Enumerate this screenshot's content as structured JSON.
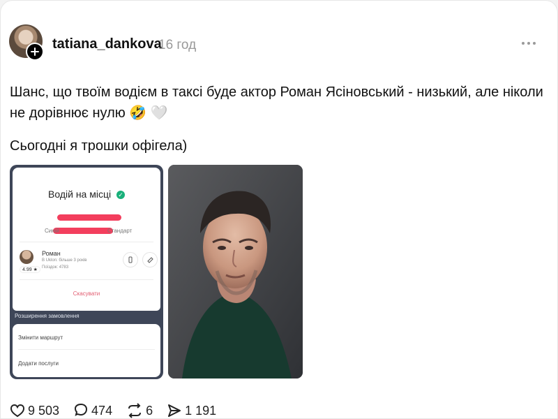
{
  "post": {
    "username": "tatiana_dankova",
    "time": "16 год",
    "text_line1": "Шанс, що твоїм водієм в таксі буде актор Роман Ясіновський - низький, але ніколи",
    "text_line2_prefix": "не дорівнює нулю",
    "emoji": [
      "🤣",
      "🤍"
    ],
    "text2": "Сьогодні я трошки офігела)"
  },
  "taxi_screenshot": {
    "title": "Водій на місці",
    "car_color": "Синій",
    "tariff": "Стандарт",
    "driver_name": "Роман",
    "rating": "4.99 ★",
    "line1": "В Uklon: більше 3 років",
    "line2": "Поїздок: 4783",
    "cancel": "Скасувати",
    "section": "Розширення замовлення",
    "option1": "Змінити маршрут",
    "option2": "Додати послуги"
  },
  "stats": {
    "likes": "9 503",
    "comments": "474",
    "reposts": "6",
    "shares": "1 191"
  },
  "colors": {
    "redaction": "#f33e5d",
    "phone_dark": "#3e4658",
    "accent_green": "#19b07a"
  },
  "icons": [
    "plus-icon",
    "more-icon",
    "check-icon",
    "phone-icon",
    "message-icon",
    "heart-icon",
    "comment-icon",
    "repost-icon",
    "share-icon"
  ]
}
